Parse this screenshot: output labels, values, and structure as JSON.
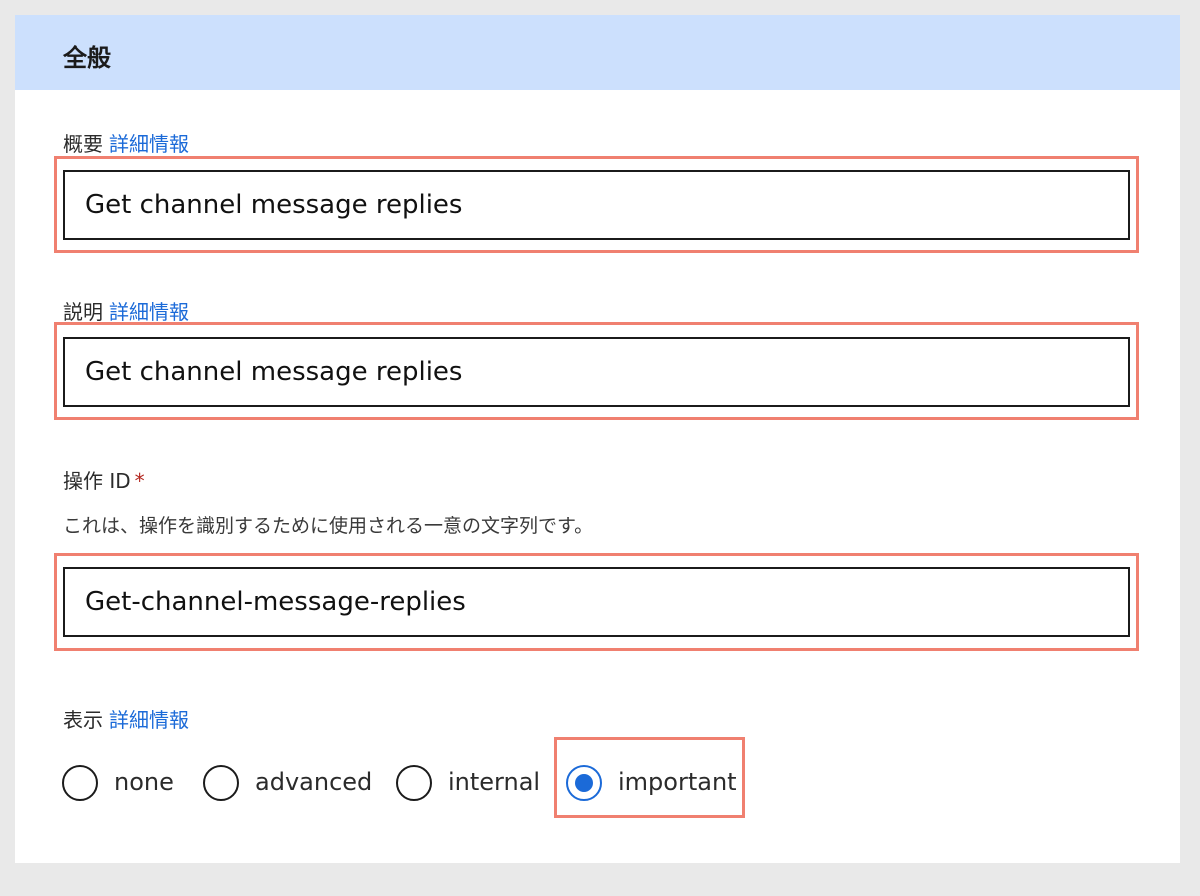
{
  "section": {
    "title": "全般"
  },
  "summary": {
    "label": "概要",
    "link": "詳細情報",
    "value": "Get channel message replies"
  },
  "description": {
    "label": "説明",
    "link": "詳細情報",
    "value": "Get channel message replies"
  },
  "operation_id": {
    "label": "操作 ID",
    "required": "*",
    "hint": "これは、操作を識別するために使用される一意の文字列です。",
    "value": "Get-channel-message-replies"
  },
  "visibility": {
    "label": "表示",
    "link": "詳細情報",
    "options": [
      {
        "label": "none",
        "checked": false
      },
      {
        "label": "advanced",
        "checked": false
      },
      {
        "label": "internal",
        "checked": false
      },
      {
        "label": "important",
        "checked": true
      }
    ]
  },
  "colors": {
    "header_bg": "#cce0fd",
    "link": "#1b6ad8",
    "highlight": "#f08070",
    "required": "#b3261e"
  }
}
